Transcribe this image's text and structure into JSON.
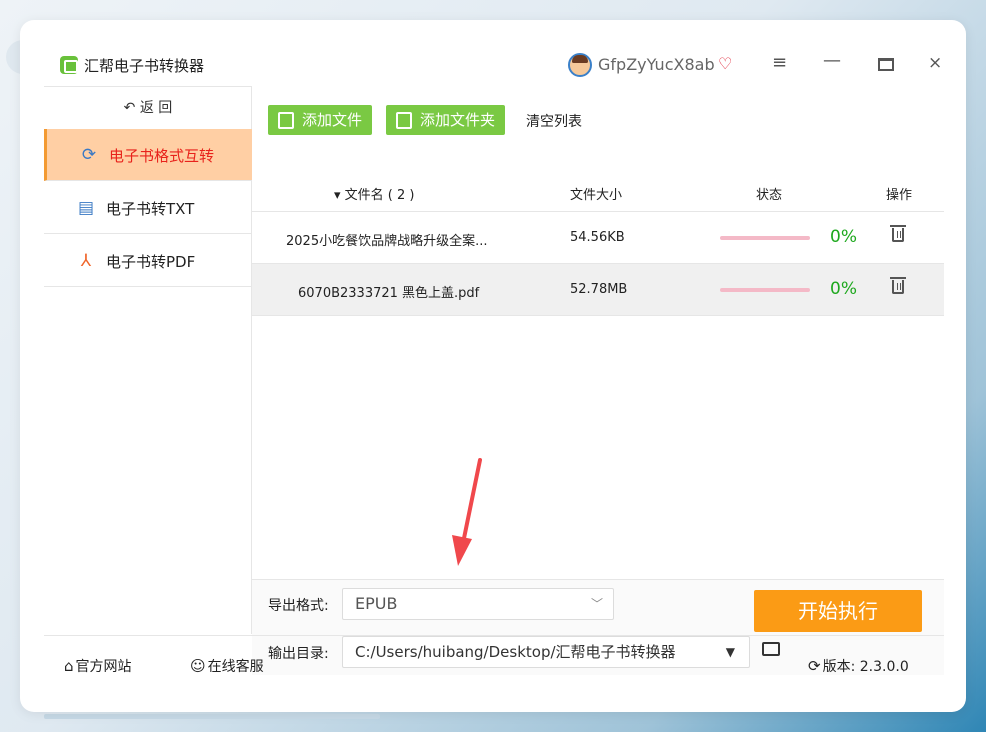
{
  "app": {
    "title": "汇帮电子书转换器",
    "username": "GfpZyYucX8ab",
    "icons": {
      "menu": "≡",
      "minimize": "—",
      "close": "×",
      "vip": "♡"
    }
  },
  "sidebar": {
    "back_label": "↶ 返  回",
    "items": [
      {
        "label": "电子书格式互转",
        "icon": "refresh-icon",
        "glyph": "⟳",
        "active": true
      },
      {
        "label": "电子书转TXT",
        "icon": "document-icon",
        "glyph": "▤",
        "active": false
      },
      {
        "label": "电子书转PDF",
        "icon": "pdf-icon",
        "glyph": "⅄",
        "active": false
      }
    ]
  },
  "toolbar": {
    "add_file": "添加文件",
    "add_folder": "添加文件夹",
    "clear_list": "清空列表"
  },
  "table": {
    "columns": {
      "name": "▾ 文件名 ( 2 )",
      "size": "文件大小",
      "status": "状态",
      "action": "操作"
    },
    "rows": [
      {
        "name": "2025小吃餐饮品牌战略升级全案...",
        "size": "54.56KB",
        "progress": 0,
        "percent": "0%",
        "selected": false
      },
      {
        "name": "6070B2333721 黑色上盖.pdf",
        "size": "52.78MB",
        "progress": 0,
        "percent": "0%",
        "selected": true
      }
    ]
  },
  "settings": {
    "format_label": "导出格式:",
    "format_value": "EPUB",
    "dir_label": "输出目录:",
    "dir_value": "C:/Users/huibang/Desktop/汇帮电子书转换器",
    "start_label": "开始执行"
  },
  "footer": {
    "website": "官方网站",
    "service": "在线客服",
    "version": "版本: 2.3.0.0"
  },
  "colors": {
    "accent_green": "#7ac943",
    "start_orange": "#fb9b15",
    "active_bg": "#ffcfa4",
    "active_text": "#e8221b",
    "percent_green": "#1ea81e",
    "arrow_red": "#f0484c"
  }
}
